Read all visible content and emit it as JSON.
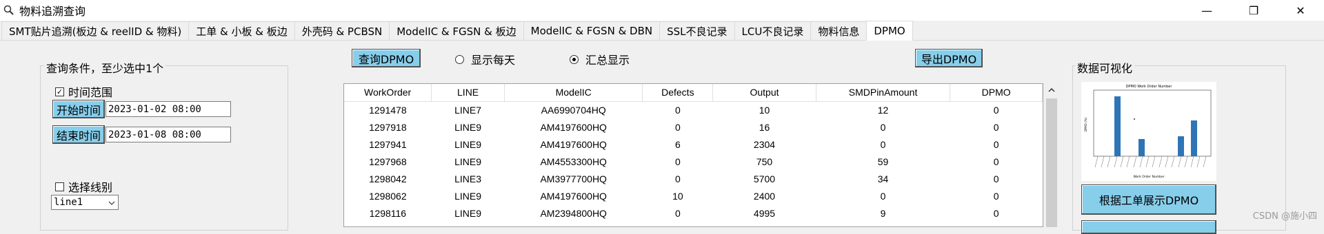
{
  "window": {
    "title": "物料追溯查询",
    "minimize_glyph": "—",
    "maximize_glyph": "❐",
    "close_glyph": "✕"
  },
  "tabs": [
    {
      "label": "SMT贴片追溯(板边 & reelID & 物料)"
    },
    {
      "label": "工单 & 小板 & 板边"
    },
    {
      "label": "外壳码 & PCBSN"
    },
    {
      "label": "ModelIC & FGSN & 板边"
    },
    {
      "label": "ModelIC & FGSN & DBN"
    },
    {
      "label": "SSL不良记录"
    },
    {
      "label": "LCU不良记录"
    },
    {
      "label": "物料信息"
    },
    {
      "label": "DPMO",
      "active": true
    }
  ],
  "query": {
    "group_title": "查询条件，至少选中1个",
    "time_range_label": "时间范围",
    "time_range_checked": true,
    "start_button": "开始时间",
    "start_value": "2023-01-02 08:00",
    "end_button": "结束时间",
    "end_value": "2023-01-08 08:00",
    "line_label": "选择线别",
    "line_checked": false,
    "line_value": "line1"
  },
  "toolbar": {
    "query_button": "查询DPMO",
    "radio_daily": "显示每天",
    "radio_summary": "汇总显示",
    "selected": "summary",
    "export_button": "导出DPMO"
  },
  "table": {
    "columns": [
      "WorkOrder",
      "LINE",
      "ModelIC",
      "Defects",
      "Output",
      "SMDPinAmount",
      "DPMO"
    ],
    "rows": [
      [
        "1291478",
        "LINE7",
        "AA6990704HQ",
        "0",
        "10",
        "12",
        "0"
      ],
      [
        "1297918",
        "LINE9",
        "AM4197600HQ",
        "0",
        "16",
        "0",
        "0"
      ],
      [
        "1297941",
        "LINE9",
        "AM4197600HQ",
        "6",
        "2304",
        "0",
        "0"
      ],
      [
        "1297968",
        "LINE9",
        "AM4553300HQ",
        "0",
        "750",
        "59",
        "0"
      ],
      [
        "1298042",
        "LINE3",
        "AM3977700HQ",
        "0",
        "5700",
        "34",
        "0"
      ],
      [
        "1298062",
        "LINE9",
        "AM4197600HQ",
        "10",
        "2400",
        "0",
        "0"
      ],
      [
        "1298116",
        "LINE9",
        "AM2394800HQ",
        "0",
        "4995",
        "9",
        "0"
      ]
    ]
  },
  "viz": {
    "group_title": "数据可视化",
    "chart_title": "DPMO Work Order Number",
    "chart_xlabel": "Work Order Number",
    "chart_ylabel": "DPMO (%)",
    "show_button": "根据工单展示DPMO"
  },
  "watermark": "CSDN @施小四"
}
